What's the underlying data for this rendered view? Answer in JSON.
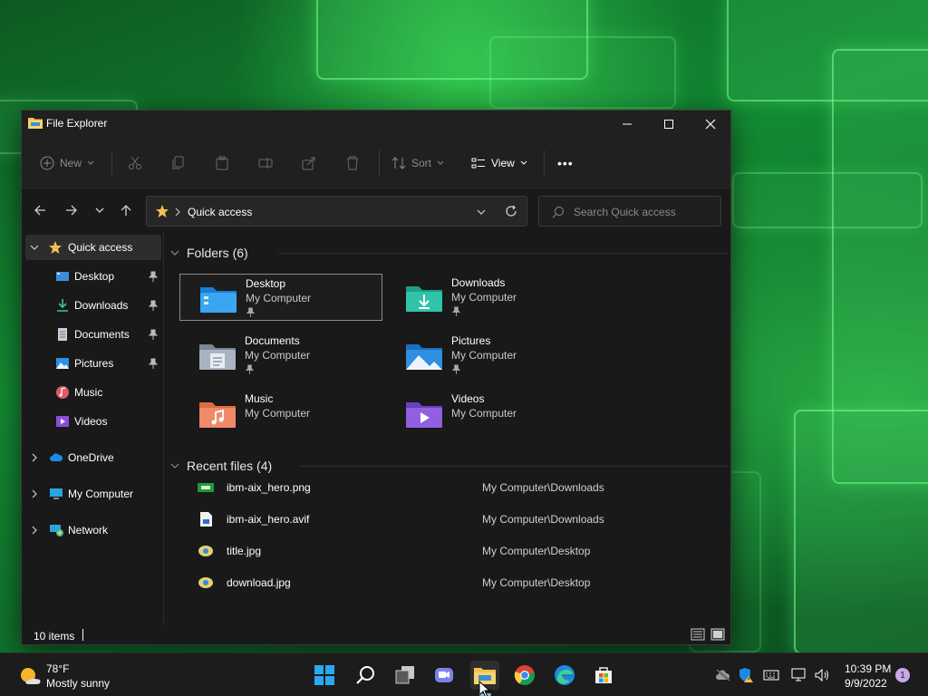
{
  "window": {
    "title": "File Explorer",
    "minimize_icon": "minimize-icon",
    "maximize_icon": "maximize-icon",
    "close_icon": "close-icon"
  },
  "toolbar": {
    "new_label": "New",
    "sort_label": "Sort",
    "view_label": "View",
    "more_label": "•••"
  },
  "navigation": {
    "address": "Quick access",
    "search_placeholder": "Search Quick access"
  },
  "sidebar": {
    "items": [
      {
        "label": "Quick access",
        "icon": "star-icon",
        "pinned": false
      },
      {
        "label": "Desktop",
        "icon": "desktop-icon",
        "pinned": true
      },
      {
        "label": "Downloads",
        "icon": "download-icon",
        "pinned": true
      },
      {
        "label": "Documents",
        "icon": "document-icon",
        "pinned": true
      },
      {
        "label": "Pictures",
        "icon": "pictures-icon",
        "pinned": true
      },
      {
        "label": "Music",
        "icon": "music-icon",
        "pinned": false
      },
      {
        "label": "Videos",
        "icon": "videos-icon",
        "pinned": false
      },
      {
        "label": "OneDrive",
        "icon": "cloud-icon",
        "pinned": false
      },
      {
        "label": "My Computer",
        "icon": "computer-icon",
        "pinned": false
      },
      {
        "label": "Network",
        "icon": "network-icon",
        "pinned": false
      }
    ]
  },
  "folders": {
    "header": "Folders (6)",
    "items": [
      {
        "name": "Desktop",
        "location": "My Computer",
        "pinned": true
      },
      {
        "name": "Downloads",
        "location": "My Computer",
        "pinned": true
      },
      {
        "name": "Documents",
        "location": "My Computer",
        "pinned": true
      },
      {
        "name": "Pictures",
        "location": "My Computer",
        "pinned": true
      },
      {
        "name": "Music",
        "location": "My Computer",
        "pinned": false
      },
      {
        "name": "Videos",
        "location": "My Computer",
        "pinned": false
      }
    ]
  },
  "recent": {
    "header": "Recent files (4)",
    "files": [
      {
        "name": "ibm-aix_hero.png",
        "path": "My Computer\\Downloads"
      },
      {
        "name": "ibm-aix_hero.avif",
        "path": "My Computer\\Downloads"
      },
      {
        "name": "title.jpg",
        "path": "My Computer\\Desktop"
      },
      {
        "name": "download.jpg",
        "path": "My Computer\\Desktop"
      }
    ]
  },
  "status": {
    "item_count": "10 items"
  },
  "taskbar": {
    "weather_temp": "78°F",
    "weather_desc": "Mostly sunny",
    "time": "10:39 PM",
    "date": "9/9/2022",
    "notification_count": "1"
  },
  "colors": {
    "accent": "#76b9ed",
    "window_bg": "#191919",
    "folder_yellow": "#f2c14e",
    "wallpaper_green": "#138a33"
  }
}
